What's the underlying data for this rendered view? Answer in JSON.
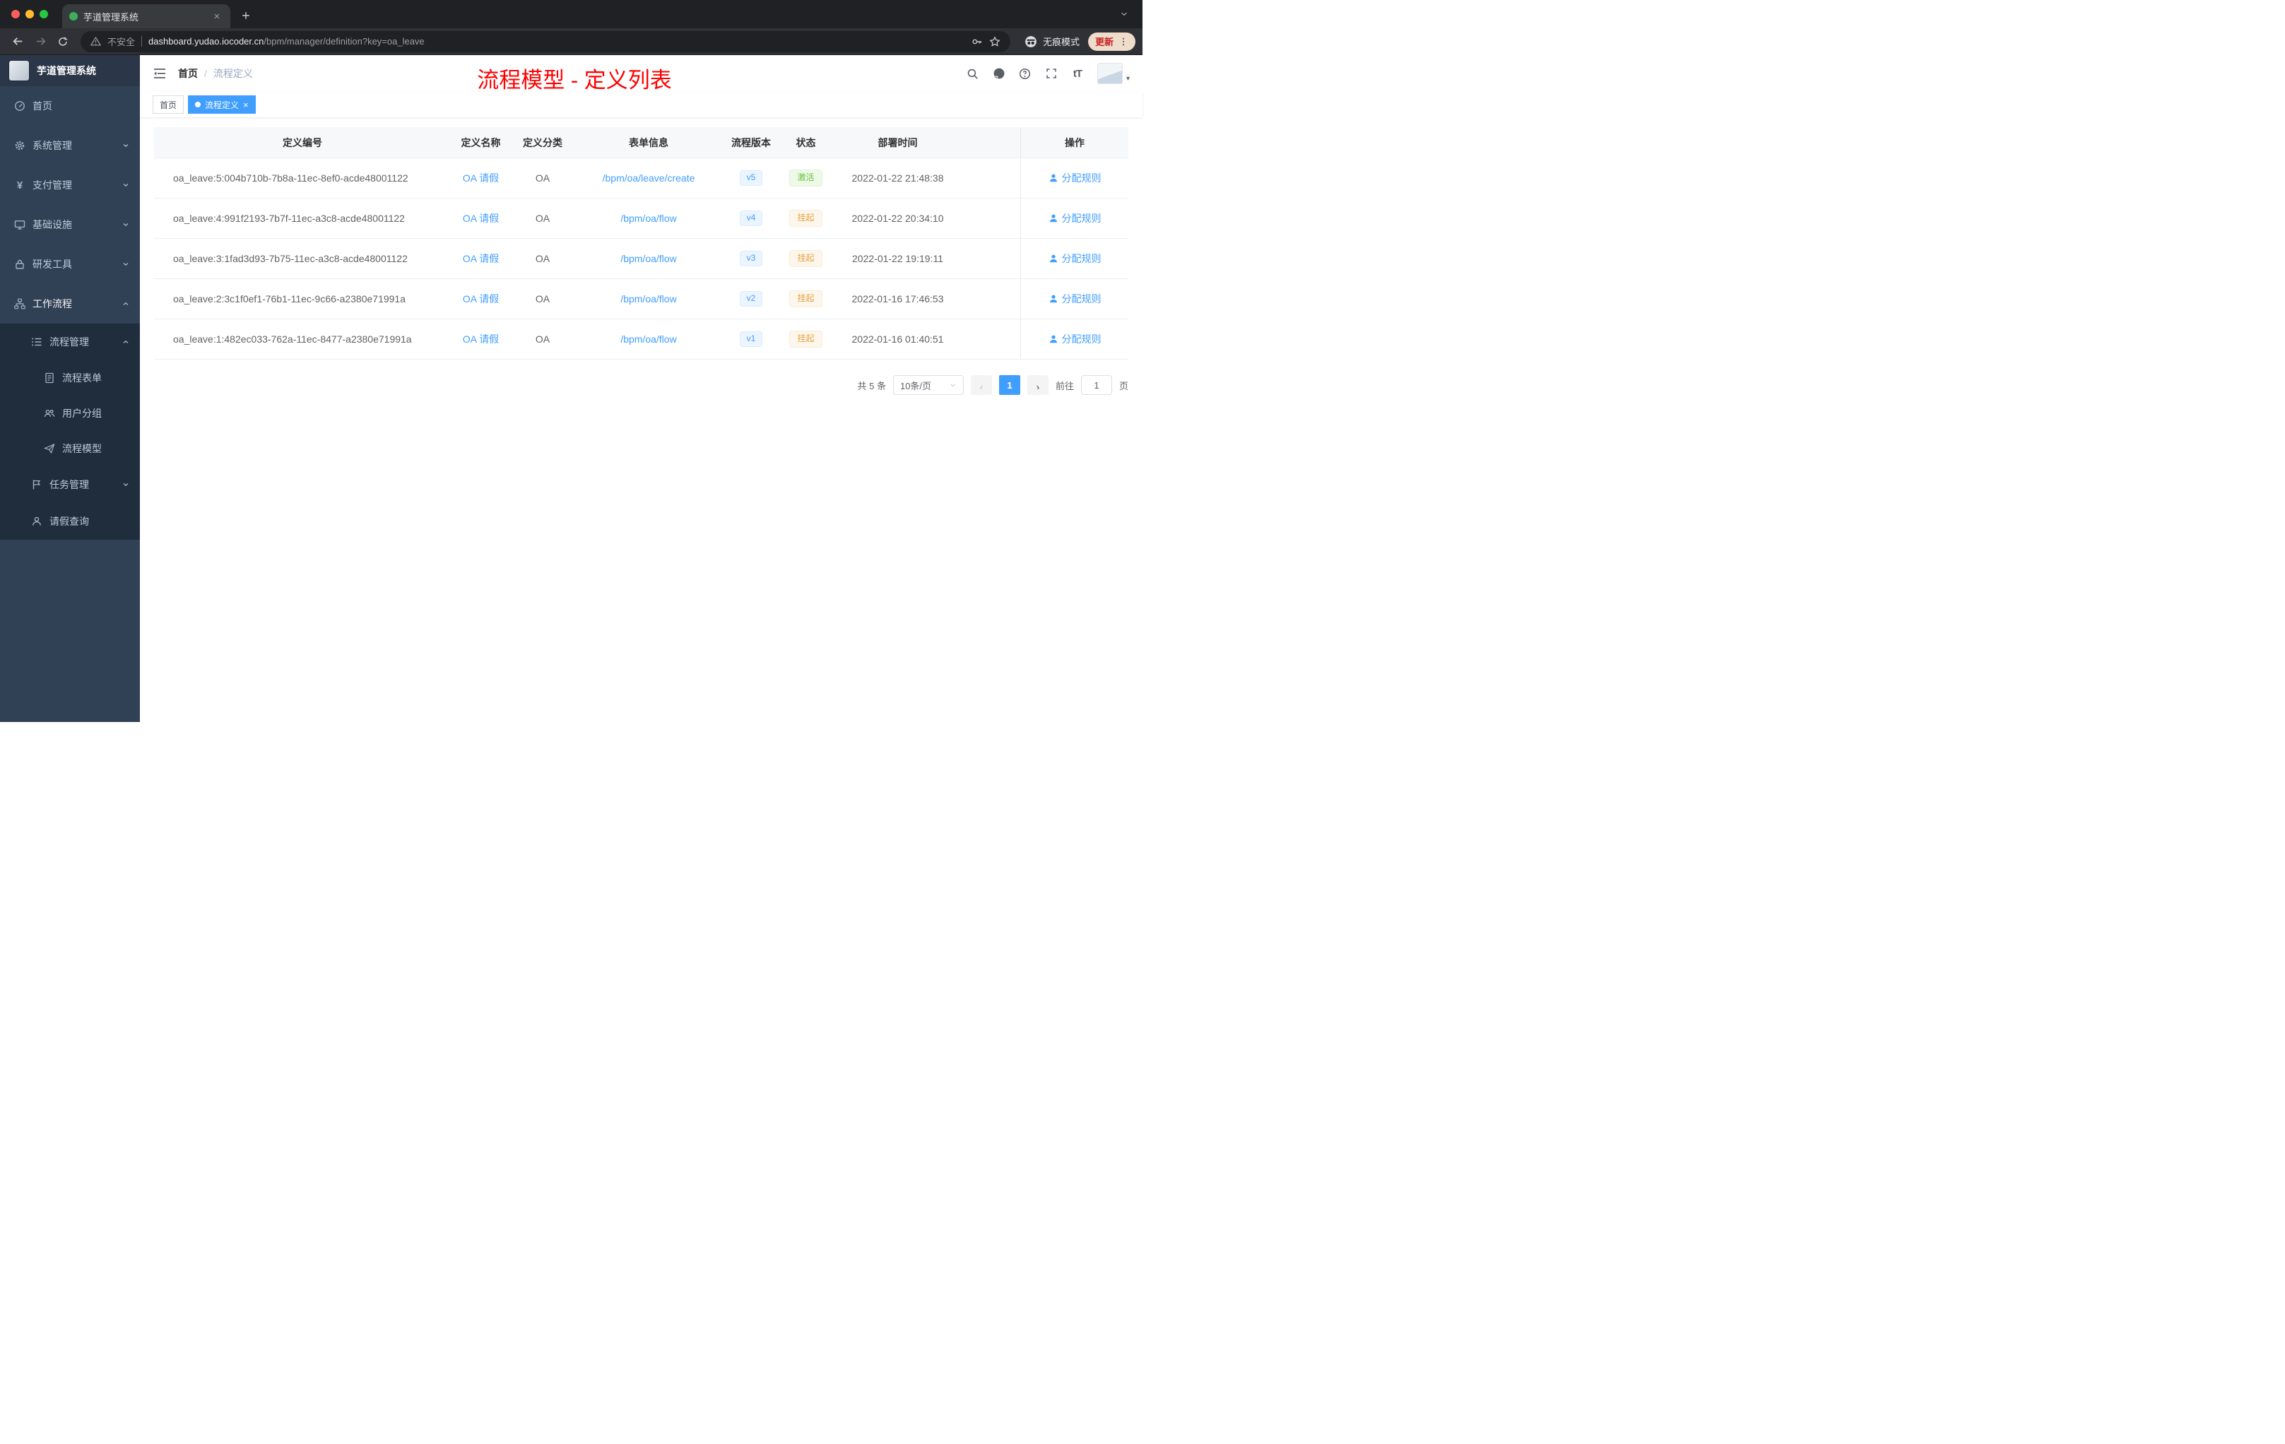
{
  "colors": {
    "accent": "#409eff",
    "success": "#67c23a",
    "warning": "#e6a23c",
    "annotation": "#ff0000"
  },
  "browser": {
    "tab_title": "芋道管理系统",
    "security_label": "不安全",
    "url_domain": "dashboard.yudao.iocoder.cn",
    "url_path": "/bpm/manager/definition?key=oa_leave",
    "incognito_label": "无痕模式",
    "update_label": "更新"
  },
  "sidebar": {
    "logo_title": "芋道管理系统",
    "items": [
      {
        "label": "首页"
      },
      {
        "label": "系统管理"
      },
      {
        "label": "支付管理"
      },
      {
        "label": "基础设施"
      },
      {
        "label": "研发工具"
      },
      {
        "label": "工作流程"
      },
      {
        "label": "流程管理"
      },
      {
        "label": "流程表单"
      },
      {
        "label": "用户分组"
      },
      {
        "label": "流程模型"
      },
      {
        "label": "任务管理"
      },
      {
        "label": "请假查询"
      }
    ]
  },
  "header": {
    "breadcrumb": {
      "home": "首页",
      "current": "流程定义"
    },
    "annotation": "流程模型 - 定义列表"
  },
  "tags": {
    "home": "首页",
    "active": "流程定义"
  },
  "table": {
    "columns": {
      "id": "定义编号",
      "name": "定义名称",
      "category": "定义分类",
      "form": "表单信息",
      "version": "流程版本",
      "status": "状态",
      "deploy_time": "部署时间",
      "action": "操作"
    },
    "rows": [
      {
        "id": "oa_leave:5:004b710b-7b8a-11ec-8ef0-acde48001122",
        "name": "OA 请假",
        "category": "OA",
        "form": "/bpm/oa/leave/create",
        "version": "v5",
        "status": "激活",
        "deploy_time": "2022-01-22 21:48:38",
        "action": "分配规则"
      },
      {
        "id": "oa_leave:4:991f2193-7b7f-11ec-a3c8-acde48001122",
        "name": "OA 请假",
        "category": "OA",
        "form": "/bpm/oa/flow",
        "version": "v4",
        "status": "挂起",
        "deploy_time": "2022-01-22 20:34:10",
        "action": "分配规则"
      },
      {
        "id": "oa_leave:3:1fad3d93-7b75-11ec-a3c8-acde48001122",
        "name": "OA 请假",
        "category": "OA",
        "form": "/bpm/oa/flow",
        "version": "v3",
        "status": "挂起",
        "deploy_time": "2022-01-22 19:19:11",
        "action": "分配规则"
      },
      {
        "id": "oa_leave:2:3c1f0ef1-76b1-11ec-9c66-a2380e71991a",
        "name": "OA 请假",
        "category": "OA",
        "form": "/bpm/oa/flow",
        "version": "v2",
        "status": "挂起",
        "deploy_time": "2022-01-16 17:46:53",
        "action": "分配规则"
      },
      {
        "id": "oa_leave:1:482ec033-762a-11ec-8477-a2380e71991a",
        "name": "OA 请假",
        "category": "OA",
        "form": "/bpm/oa/flow",
        "version": "v1",
        "status": "挂起",
        "deploy_time": "2022-01-16 01:40:51",
        "action": "分配规则"
      }
    ]
  },
  "pagination": {
    "total": "共 5 条",
    "page_size": "10条/页",
    "page": "1",
    "goto_label": "前往",
    "goto_value": "1",
    "page_unit": "页"
  }
}
